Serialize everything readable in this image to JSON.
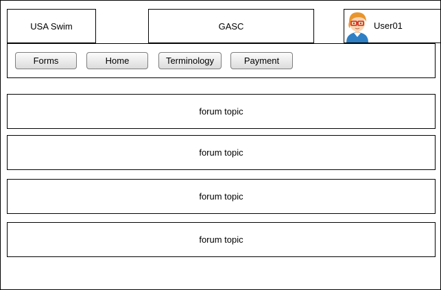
{
  "header": {
    "brand": "USA Swim",
    "club": "GASC",
    "user": {
      "name": "User01",
      "avatar_icon": "user-avatar-icon"
    }
  },
  "nav": {
    "buttons": [
      {
        "label": "Forms"
      },
      {
        "label": "Home"
      },
      {
        "label": "Terminology"
      },
      {
        "label": "Payment"
      }
    ]
  },
  "topics": [
    {
      "label": "forum topic"
    },
    {
      "label": "forum topic"
    },
    {
      "label": "forum topic"
    },
    {
      "label": "forum topic"
    }
  ],
  "colors": {
    "border": "#000000",
    "button_top": "#fbfbfb",
    "button_bottom": "#dcdcdc",
    "avatar_hair": "#e8952e",
    "avatar_shirt": "#2f7fc4",
    "avatar_glasses": "#d3241c"
  }
}
